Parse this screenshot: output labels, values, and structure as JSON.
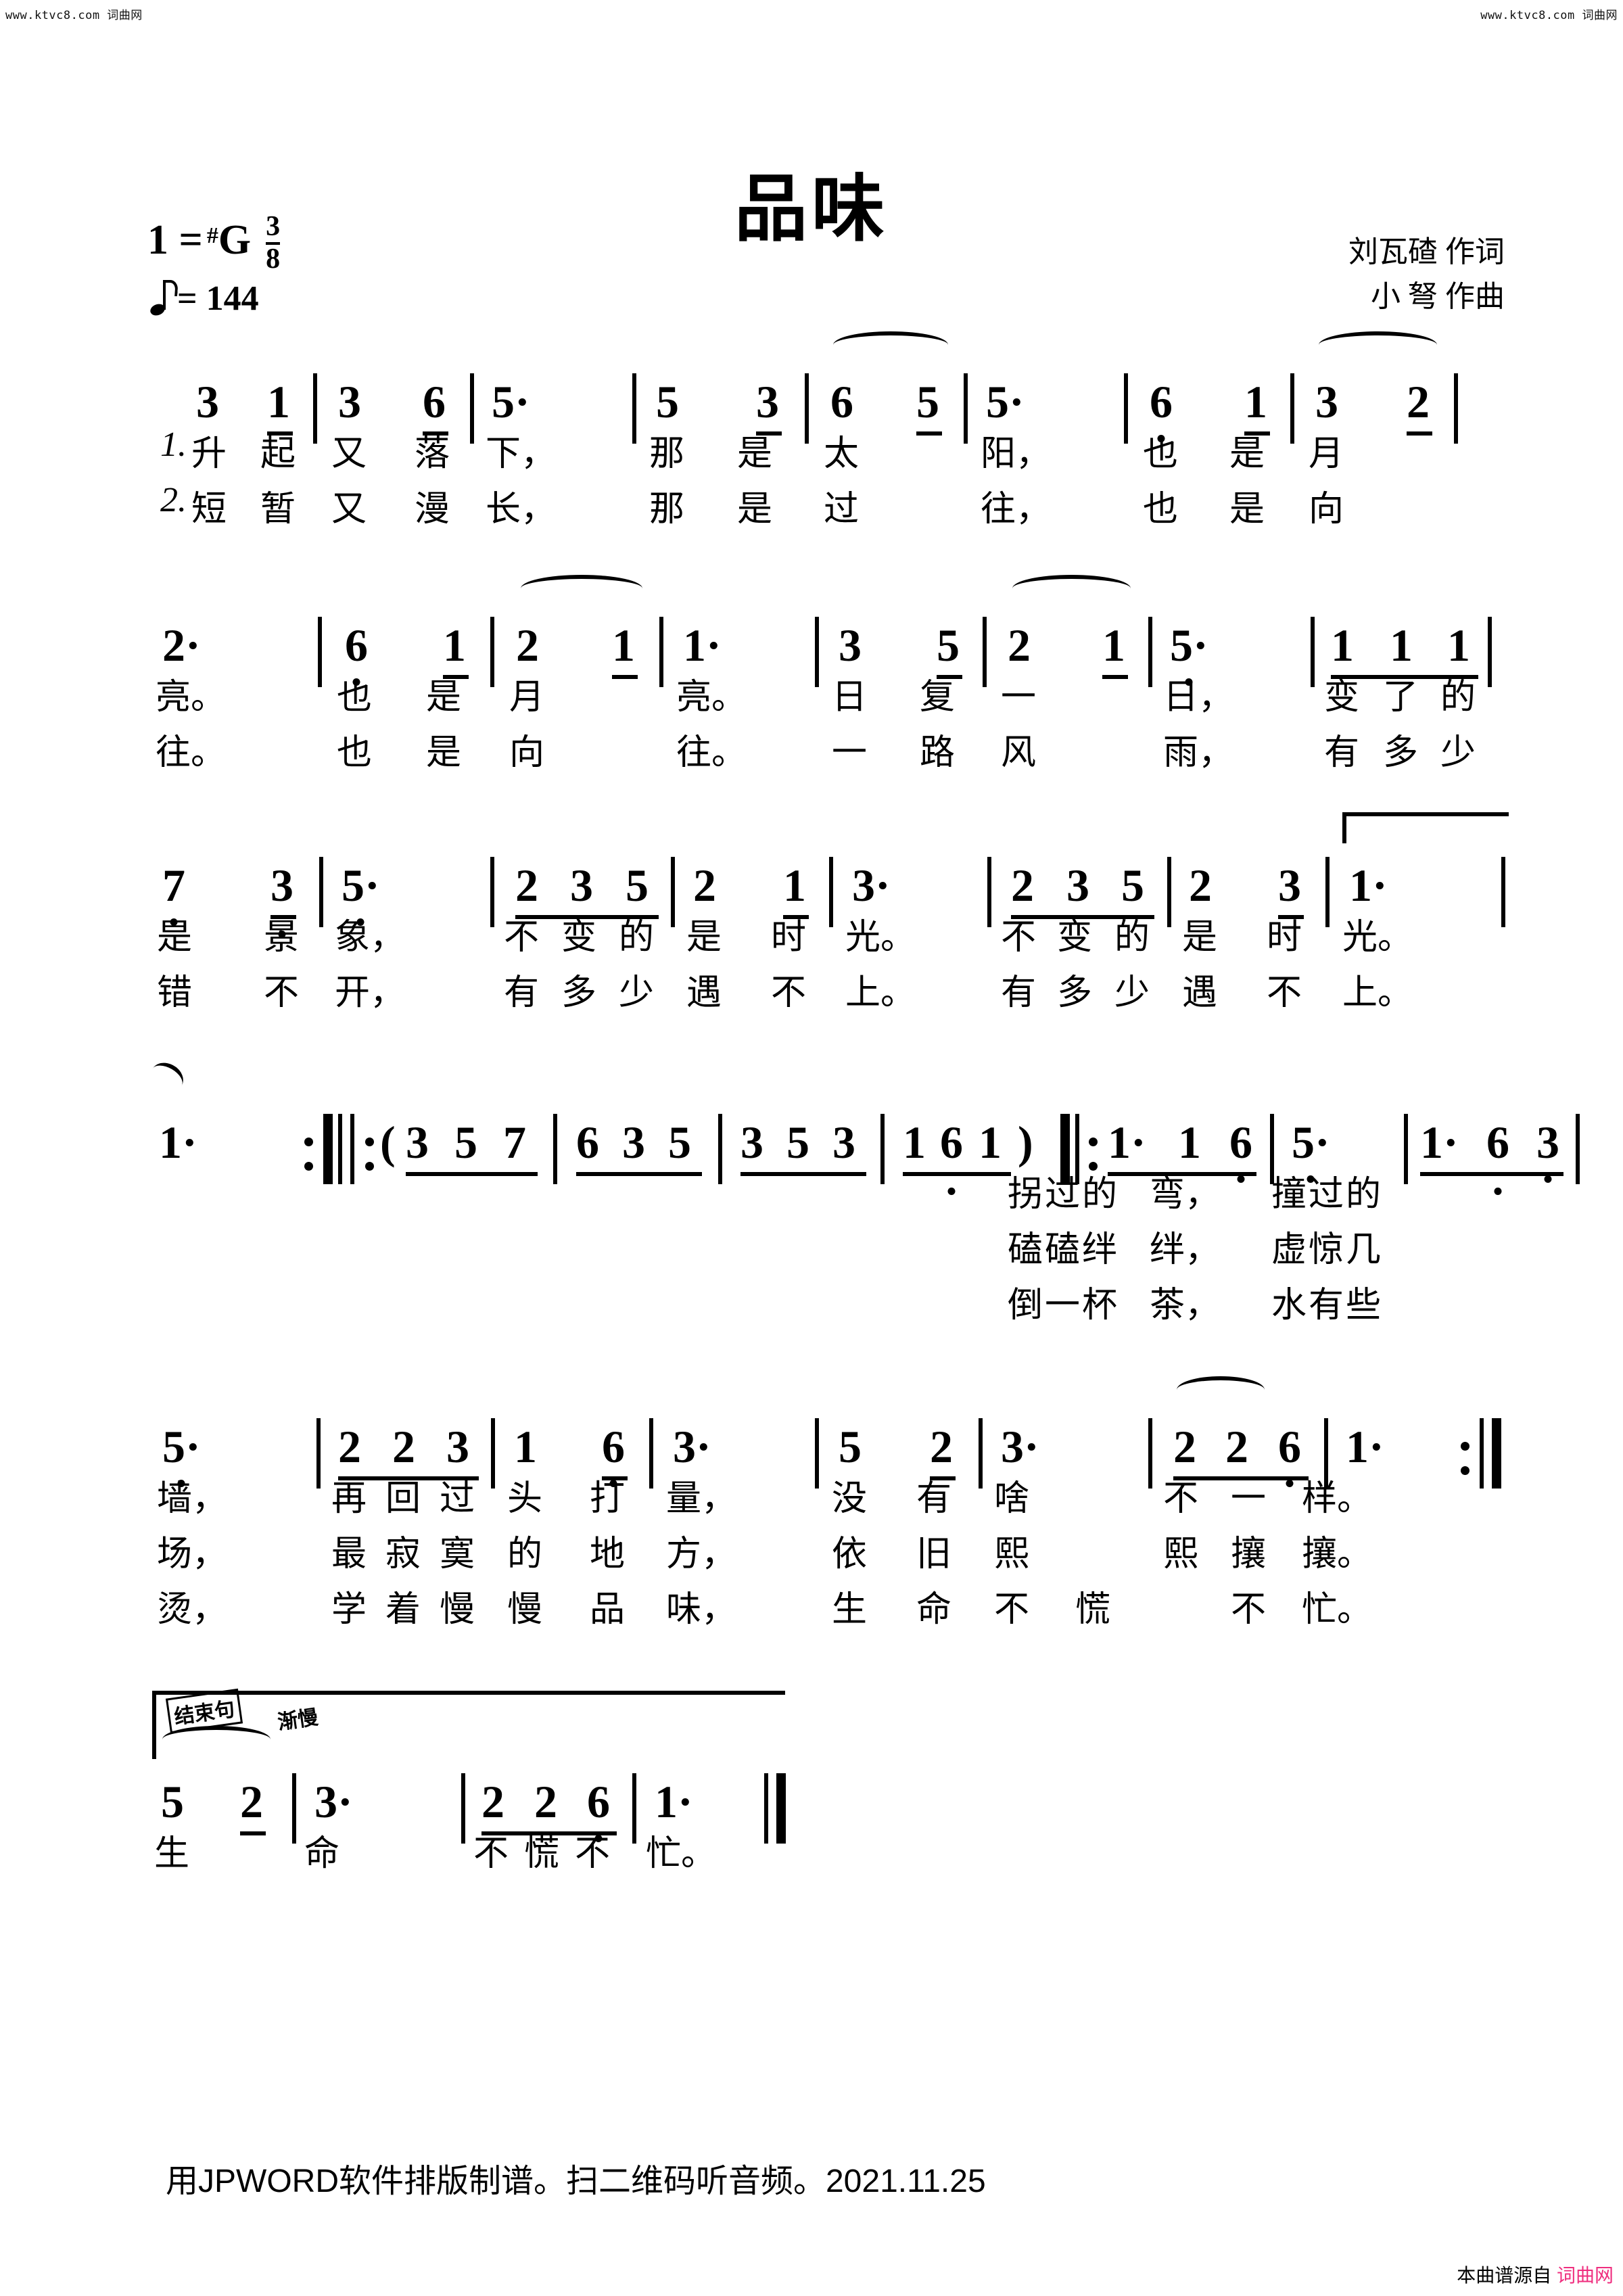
{
  "watermarks": {
    "top_left": "www.ktvc8.com 词曲网",
    "top_right": "www.ktvc8.com 词曲网",
    "bottom_right_prefix": "本曲谱源自",
    "bottom_right_site": "词曲网",
    "bottom_right_color": "#ef2d7e"
  },
  "header": {
    "title": "品味",
    "key_label": "1 =",
    "key_accidental": "#",
    "key_note": "G",
    "meter_numerator": "3",
    "meter_denominator": "8",
    "tempo_equals": "= 144",
    "lyricist": "刘瓦碴  作词",
    "composer": "小  弩  作曲"
  },
  "footer": {
    "text": "用JPWORD软件排版制谱。扫二维码听音频。2021.11.25"
  },
  "chart_data": {
    "type": "table",
    "title": "品味 — 简谱 (Chinese numbered notation)",
    "key": "1 = #G",
    "time_signature": "3/8",
    "tempo": "♪ = 144",
    "systems": [
      {
        "index": 1,
        "notes": "3 1 | 3 6 | 5· | 5 3 | 6 5 | 5· | 6̣ 1 | 3 2 |",
        "lyrics_v1": "1.升 起 又 落 下，  那 是 太  阳，  也 是 月",
        "lyrics_v2": "2.短 暂 又 漫 长，  那 是 过  往，  也 是 向"
      },
      {
        "index": 2,
        "notes": "2· | 6̣ 1 | 2 1 | 1· | 3 5 | 2 1 | 5̣· | 1 1 1 |",
        "lyrics_v1": "亮。  也 是 月  亮。  日 复 一  日，  变了的",
        "lyrics_v2": "往。  也 是 向  往。  一 路 风  雨，  有多少"
      },
      {
        "index": 3,
        "notes": "7̣ 3̣ | 5̣· | 2 3 5 | 2 1 | 3· | 2 3 5 | 2 3 | 1· |",
        "lyrics_v1": "是 景 象，  不变的 是 时 光。  不变的 是 时 光。",
        "lyrics_v2": "错 不 开，  有多少 遇 不 上。  有多少 遇 不 上。"
      },
      {
        "index": 4,
        "notes": "1· :‖ ‖: (3 5 7 | 6 3 5 | 3 5 3 | 1 6̣ 1) ‖: 1· 1 6̣ | 5̣· | 1· 6̣ 3̣ |",
        "lyrics_v1": "拐过的 弯，  撞过的",
        "lyrics_v2": "磕磕绊 绊，  虚惊几",
        "lyrics_v3": "倒一杯 茶，  水有些"
      },
      {
        "index": 5,
        "notes": "5̣· | 2 2 3 | 1 6̣ | 3· | 5 2 | 3· | 2 2 6̣ | 1· :‖",
        "lyrics_v1": "墙，  再回过 头 打 量，  没 有 啥  不 一 样。",
        "lyrics_v2": "场，  最寂寞 的 地 方，  依 旧 熙  熙 攘 攘。",
        "lyrics_v3": "烫，  学着慢 慢 品 味，  生 命 不 慌 不 忙。"
      },
      {
        "index": 6,
        "label": "结束句",
        "direction": "渐慢",
        "notes": "5 2 | 3· | 2 2 6̣ | 1· ‖",
        "lyrics_v1": "生 命 不慌不 忙。"
      }
    ]
  },
  "s1": {
    "n": [
      "3",
      "1",
      "3",
      "6",
      "5",
      "·",
      "5",
      "3",
      "6",
      "5",
      "5",
      "·",
      "6",
      "1",
      "3",
      "2"
    ],
    "l1": [
      "1.",
      "升",
      "起",
      "又",
      "落",
      "下，",
      "那",
      "是",
      "太",
      "阳，",
      "也",
      "是",
      "月"
    ],
    "l2": [
      "2.",
      "短",
      "暂",
      "又",
      "漫",
      "长，",
      "那",
      "是",
      "过",
      "往，",
      "也",
      "是",
      "向"
    ]
  },
  "s2": {
    "n": [
      "2",
      "·",
      "6",
      "1",
      "2",
      "1",
      "1",
      "·",
      "3",
      "5",
      "2",
      "1",
      "5",
      "·",
      "1",
      "1",
      "1"
    ],
    "l1": [
      "亮。",
      "也",
      "是",
      "月",
      "亮。",
      "日",
      "复",
      "一",
      "日，",
      "变",
      "了",
      "的"
    ],
    "l2": [
      "往。",
      "也",
      "是",
      "向",
      "往。",
      "一",
      "路",
      "风",
      "雨，",
      "有",
      "多",
      "少"
    ]
  },
  "s3": {
    "n": [
      "7",
      "3",
      "5",
      "·",
      "2",
      "3",
      "5",
      "2",
      "1",
      "3",
      "·",
      "2",
      "3",
      "5",
      "2",
      "3",
      "1",
      "·"
    ],
    "l1": [
      "是",
      "景",
      "象，",
      "不",
      "变",
      "的",
      "是",
      "时",
      "光。",
      "不",
      "变",
      "的",
      "是",
      "时",
      "光。"
    ],
    "l2": [
      "错",
      "不",
      "开，",
      "有",
      "多",
      "少",
      "遇",
      "不",
      "上。",
      "有",
      "多",
      "少",
      "遇",
      "不",
      "上。"
    ]
  },
  "s4": {
    "n": [
      "1",
      "·",
      "(",
      "3",
      "5",
      "7",
      "6",
      "3",
      "5",
      "3",
      "5",
      "3",
      "1",
      "6",
      "1",
      ")",
      "1",
      "·",
      "1",
      "6",
      "5",
      "·",
      "1",
      "·",
      "6",
      "3"
    ],
    "l1": [
      "拐",
      "过",
      "的",
      "弯，",
      "撞",
      "过",
      "的"
    ],
    "l2": [
      "磕",
      "磕",
      "绊",
      "绊，",
      "虚",
      "惊",
      "几"
    ],
    "l3": [
      "倒",
      "一",
      "杯",
      "茶，",
      "水",
      "有",
      "些"
    ]
  },
  "s5": {
    "n": [
      "5",
      "·",
      "2",
      "2",
      "3",
      "1",
      "6",
      "3",
      "·",
      "5",
      "2",
      "3",
      "·",
      "2",
      "2",
      "6",
      "1",
      "·"
    ],
    "l1": [
      "墙，",
      "再",
      "回",
      "过",
      "头",
      "打",
      "量，",
      "没",
      "有",
      "啥",
      "不",
      "一",
      "样。"
    ],
    "l2": [
      "场，",
      "最",
      "寂",
      "寞",
      "的",
      "地",
      "方，",
      "依",
      "旧",
      "熙",
      "熙",
      "攘",
      "攘。"
    ],
    "l3": [
      "烫，",
      "学",
      "着",
      "慢",
      "慢",
      "品",
      "味，",
      "生",
      "命",
      "不",
      "慌",
      "不",
      "忙。"
    ]
  },
  "s6": {
    "label": "结束句",
    "direction": "渐慢",
    "n": [
      "5",
      "2",
      "3",
      "·",
      "2",
      "2",
      "6",
      "1",
      "·"
    ],
    "l1": [
      "生",
      "命",
      "不",
      "慌",
      "不",
      "忙。"
    ]
  }
}
